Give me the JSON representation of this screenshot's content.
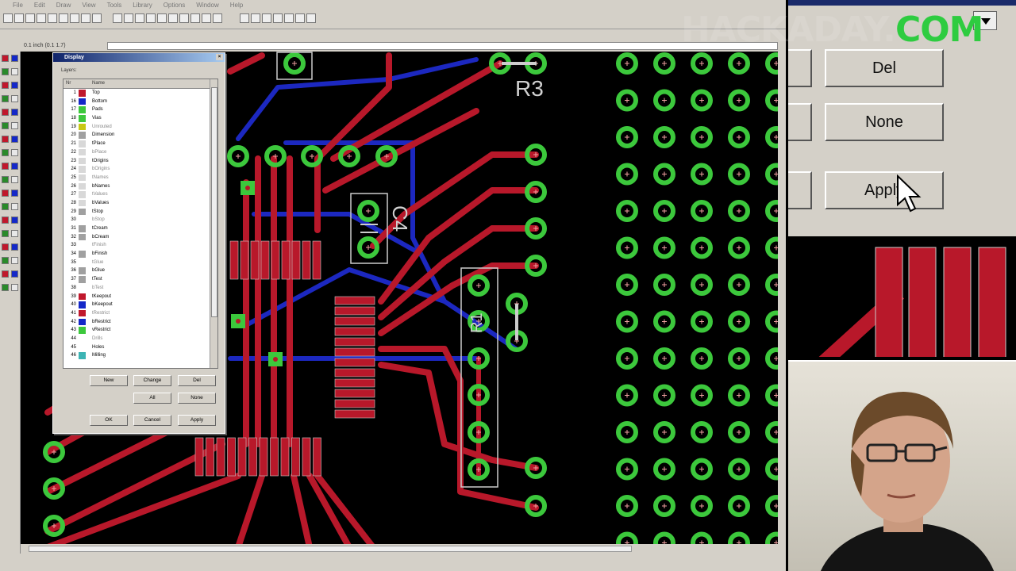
{
  "menubar": {
    "items": [
      "File",
      "Edit",
      "Draw",
      "View",
      "Tools",
      "Library",
      "Options",
      "Window",
      "Help"
    ]
  },
  "coordinate_readout": "0.1 inch (0.1 1.7)",
  "canvas": {
    "labels": {
      "r3": "R3",
      "c4": "C4",
      "r1": "R1"
    }
  },
  "display_dialog": {
    "title": "Display",
    "layers_label": "Layers:",
    "columns": {
      "nr": "Nr",
      "name": "Name"
    },
    "layers": [
      {
        "nr": "1",
        "name": "Top",
        "color": "#c0182c",
        "dim": false
      },
      {
        "nr": "16",
        "name": "Bottom",
        "color": "#1428c8",
        "dim": false
      },
      {
        "nr": "17",
        "name": "Pads",
        "color": "#3cc83c",
        "dim": false
      },
      {
        "nr": "18",
        "name": "Vias",
        "color": "#3cc83c",
        "dim": false
      },
      {
        "nr": "19",
        "name": "Unrouted",
        "color": "#c8c814",
        "dim": true
      },
      {
        "nr": "20",
        "name": "Dimension",
        "color": "#a0a0a0",
        "dim": false
      },
      {
        "nr": "21",
        "name": "tPlace",
        "color": "#d8d8d8",
        "dim": false
      },
      {
        "nr": "22",
        "name": "bPlace",
        "color": "#d8d8d8",
        "dim": true
      },
      {
        "nr": "23",
        "name": "tOrigins",
        "color": "#d8d8d8",
        "dim": false
      },
      {
        "nr": "24",
        "name": "bOrigins",
        "color": "#d8d8d8",
        "dim": true
      },
      {
        "nr": "25",
        "name": "tNames",
        "color": "#d8d8d8",
        "dim": true
      },
      {
        "nr": "26",
        "name": "bNames",
        "color": "#d8d8d8",
        "dim": false
      },
      {
        "nr": "27",
        "name": "tValues",
        "color": "#d8d8d8",
        "dim": true
      },
      {
        "nr": "28",
        "name": "bValues",
        "color": "#d8d8d8",
        "dim": false
      },
      {
        "nr": "29",
        "name": "tStop",
        "color": "#a0a0a0",
        "dim": false
      },
      {
        "nr": "30",
        "name": "bStop",
        "color": "#ffffff",
        "dim": true
      },
      {
        "nr": "31",
        "name": "tCream",
        "color": "#a0a0a0",
        "dim": false
      },
      {
        "nr": "32",
        "name": "bCream",
        "color": "#a0a0a0",
        "dim": false
      },
      {
        "nr": "33",
        "name": "tFinish",
        "color": "#ffffff",
        "dim": true
      },
      {
        "nr": "34",
        "name": "bFinish",
        "color": "#a0a0a0",
        "dim": false
      },
      {
        "nr": "35",
        "name": "tGlue",
        "color": "#ffffff",
        "dim": true
      },
      {
        "nr": "36",
        "name": "bGlue",
        "color": "#a0a0a0",
        "dim": false
      },
      {
        "nr": "37",
        "name": "tTest",
        "color": "#a0a0a0",
        "dim": false
      },
      {
        "nr": "38",
        "name": "bTest",
        "color": "#ffffff",
        "dim": true
      },
      {
        "nr": "39",
        "name": "tKeepout",
        "color": "#c0182c",
        "dim": false
      },
      {
        "nr": "40",
        "name": "bKeepout",
        "color": "#1428c8",
        "dim": false
      },
      {
        "nr": "41",
        "name": "tRestrict",
        "color": "#c0182c",
        "dim": true
      },
      {
        "nr": "42",
        "name": "bRestrict",
        "color": "#1428c8",
        "dim": false
      },
      {
        "nr": "43",
        "name": "vRestrict",
        "color": "#3cc83c",
        "dim": false
      },
      {
        "nr": "44",
        "name": "Drills",
        "color": "#ffffff",
        "dim": true
      },
      {
        "nr": "45",
        "name": "Holes",
        "color": "#ffffff",
        "dim": false
      },
      {
        "nr": "46",
        "name": "Milling",
        "color": "#3cb4b4",
        "dim": false
      }
    ],
    "buttons": {
      "new": "New",
      "change": "Change",
      "del": "Del",
      "all": "All",
      "none": "None",
      "ok": "OK",
      "cancel": "Cancel",
      "apply": "Apply"
    }
  },
  "zoom_panel": {
    "del": "Del",
    "none": "None",
    "apply": "Apply"
  },
  "watermark": "HACKADAY.COM",
  "colors": {
    "top_layer": "#b8182a",
    "bottom_layer": "#1c28c0",
    "pad": "#3cc83c",
    "dialog_bg": "#d4d0c8",
    "title_bar": "#10246a"
  }
}
